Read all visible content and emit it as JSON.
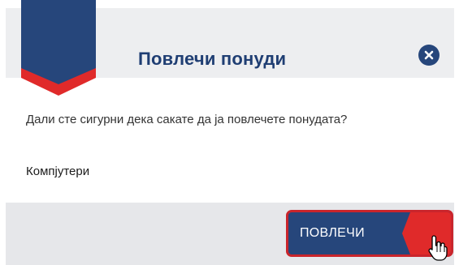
{
  "dialog": {
    "title": "Повлечи понуди",
    "message": "Дали сте сигурни дека сакате да ја повлечете понудата?",
    "item_name": "Компјутери",
    "confirm_label": "ПОВЛЕЧИ"
  },
  "colors": {
    "brand_navy": "#26467b",
    "title_blue": "#1f3e73",
    "accent_red": "#e02a2a",
    "header_bg": "#edeef0",
    "footer_bg": "#e6e7ea"
  },
  "icons": {
    "close": "close-circle-icon",
    "cursor": "hand-pointer-cursor-icon",
    "ribbon": "bookmark-ribbon"
  }
}
